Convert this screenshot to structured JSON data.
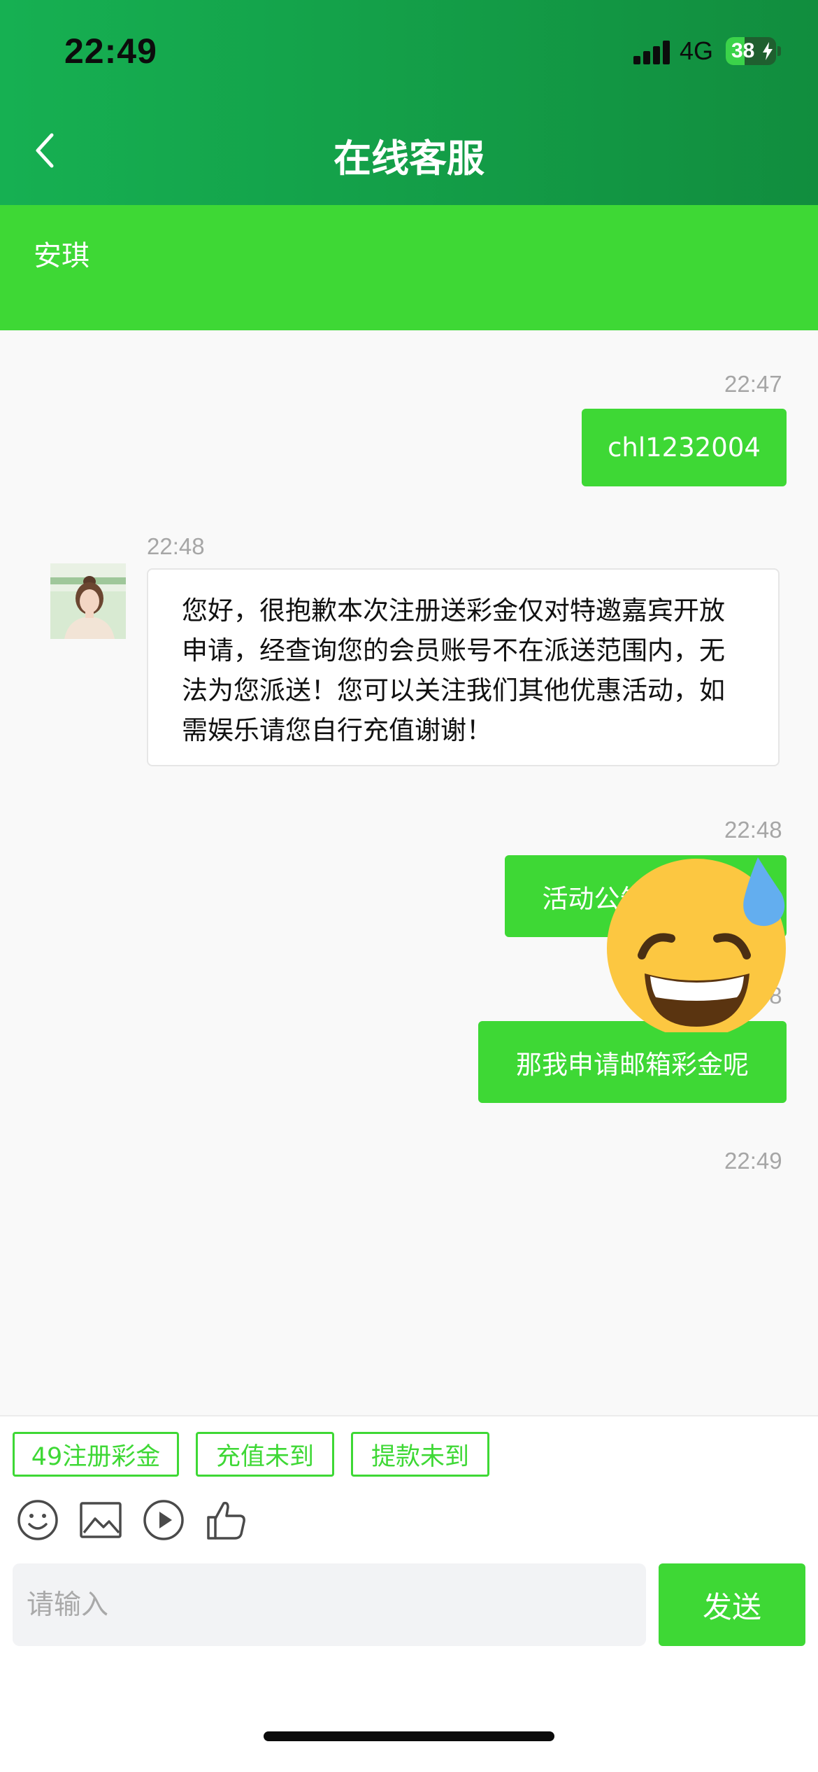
{
  "status_bar": {
    "time": "22:49",
    "network": "4G",
    "battery": "38",
    "battery_level_percent": 38
  },
  "nav": {
    "title": "在线客服",
    "back_icon": "chevron-left-icon"
  },
  "agent": {
    "name": "安琪"
  },
  "messages": [
    {
      "direction": "out",
      "time": "22:47",
      "text": "chl1232004"
    },
    {
      "direction": "in",
      "time": "22:48",
      "text": "您好，很抱歉本次注册送彩金仅对特邀嘉宾开放申请，经查询您的会员账号不在派送范围内，无法为您派送！您可以关注我们其他优惠活动，如需娱乐请您自行充值谢谢！"
    },
    {
      "direction": "out",
      "time": "22:48",
      "text": "活动公告也没写啊"
    },
    {
      "direction": "out",
      "time": "22:48",
      "text": "那我申请邮箱彩金呢"
    },
    {
      "direction": "out",
      "time": "22:49",
      "emoji": "grinning-face-with-sweat"
    }
  ],
  "quick_replies": [
    "49注册彩金",
    "充值未到",
    "提款未到"
  ],
  "toolbar": {
    "icons": [
      "smiley-icon",
      "image-icon",
      "video-play-icon",
      "thumbs-up-icon"
    ]
  },
  "composer": {
    "placeholder": "请输入",
    "send_label": "发送"
  },
  "colors": {
    "header_start": "#16b052",
    "header_end": "#118d3e",
    "accent": "#3ed835",
    "background": "#f9f9f9",
    "timestamp": "#a6a6a6"
  }
}
